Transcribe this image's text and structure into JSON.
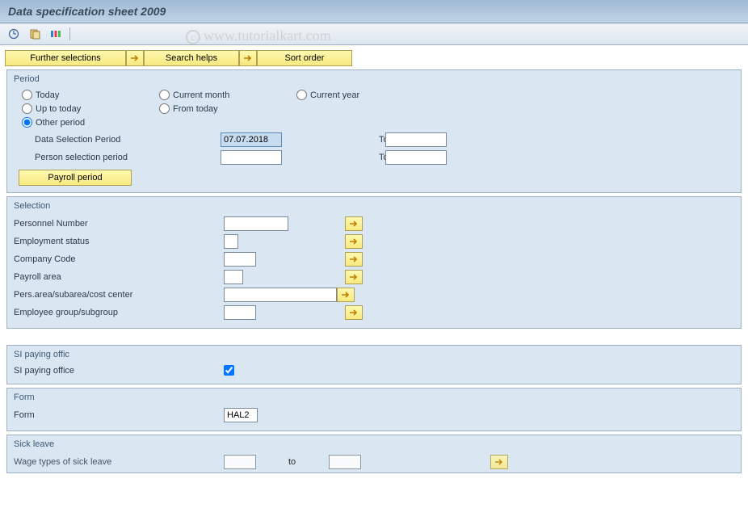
{
  "title": "Data specification sheet 2009",
  "watermark": "www.tutorialkart.com",
  "buttons": {
    "further_selections": "Further selections",
    "search_helps": "Search helps",
    "sort_order": "Sort order",
    "payroll_period": "Payroll period"
  },
  "period": {
    "title": "Period",
    "radios": {
      "today": "Today",
      "current_month": "Current month",
      "current_year": "Current year",
      "up_to_today": "Up to today",
      "from_today": "From today",
      "other_period": "Other period"
    },
    "data_selection_label": "Data Selection Period",
    "data_selection_from": "07.07.2018",
    "data_selection_to": "",
    "person_selection_label": "Person selection period",
    "person_selection_from": "",
    "person_selection_to": "",
    "to_label": "To"
  },
  "selection": {
    "title": "Selection",
    "personnel_number": "Personnel Number",
    "employment_status": "Employment status",
    "company_code": "Company Code",
    "payroll_area": "Payroll area",
    "pers_area": "Pers.area/subarea/cost center",
    "employee_group": "Employee group/subgroup"
  },
  "si_paying": {
    "title": "SI paying offic",
    "label": "SI paying office"
  },
  "form": {
    "title": "Form",
    "label": "Form",
    "value": "HAL2"
  },
  "sick_leave": {
    "title": "Sick leave",
    "label": "Wage types of sick leave",
    "to_label": "to"
  }
}
